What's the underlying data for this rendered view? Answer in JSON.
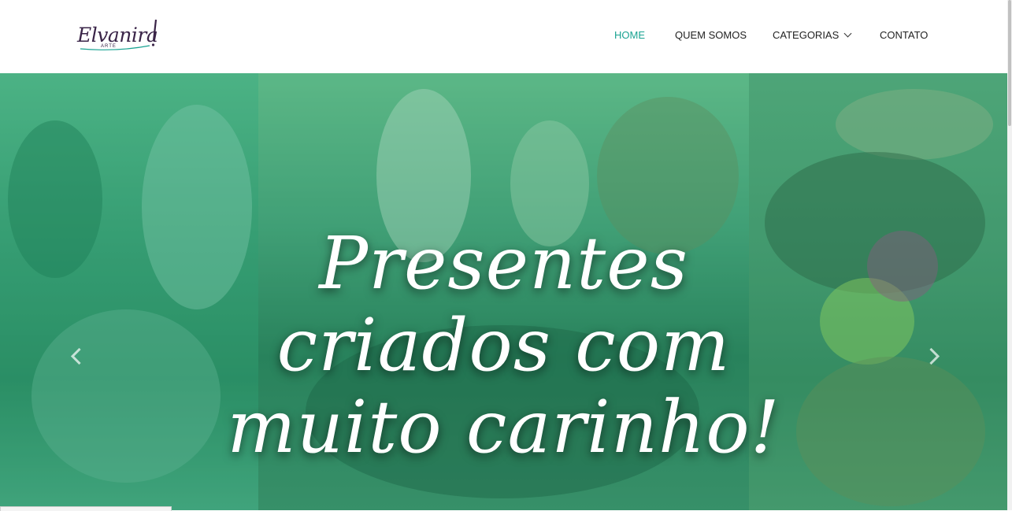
{
  "logo": {
    "name": "Elvanira",
    "subtitle": "ARTE"
  },
  "nav": [
    {
      "label": "HOME",
      "active": true
    },
    {
      "label": "QUEM SOMOS",
      "active": false
    },
    {
      "label": "CATEGORIAS",
      "active": false,
      "has_dropdown": true
    },
    {
      "label": "CONTATO",
      "active": false
    }
  ],
  "hero": {
    "headline_line1": "Presentes",
    "headline_line2": "criados com",
    "headline_line3": "muito carinho!"
  },
  "colors": {
    "accent": "#1aa392",
    "logo": "#3a2448",
    "hero_tint": "#3fa87a"
  },
  "icons": [
    "chevron-down-icon",
    "carousel-prev-icon",
    "carousel-next-icon"
  ]
}
